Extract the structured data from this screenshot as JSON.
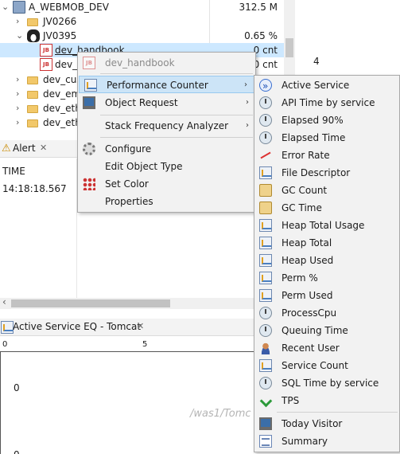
{
  "tree": {
    "rows": [
      {
        "label": "A_WEBMOB_DEV",
        "value": "312.5 M"
      },
      {
        "label": "JV0266",
        "value": ""
      },
      {
        "label": "JV0395",
        "value": "0.65 %"
      },
      {
        "label": "dev_handbook",
        "value": "0 cnt"
      },
      {
        "label": "dev_h",
        "value": "0 cnt"
      },
      {
        "label": "dev_cust",
        "value": ""
      },
      {
        "label": "dev_emp",
        "value": ""
      },
      {
        "label": "dev_ethi",
        "value": ""
      },
      {
        "label": "dev_ethi",
        "value": ""
      }
    ]
  },
  "right_top": {
    "axis_label": "4"
  },
  "alert": {
    "tab_label": "Alert",
    "close_glyph": "✕",
    "column_header": "TIME",
    "rows": [
      "14:18:18.567"
    ]
  },
  "eq": {
    "tab_label": "Active Service EQ - Tomcat",
    "close_glyph": "✕",
    "ruler": [
      "0",
      "5"
    ],
    "y_label": "0",
    "y_label2": "0",
    "watermark": "/was1/Tomc"
  },
  "context_menu": {
    "header": "dev_handbook",
    "items": [
      {
        "label": "Performance Counter",
        "submenu": true,
        "icon": "chart-icon"
      },
      {
        "label": "Object Request",
        "submenu": true,
        "icon": "monitor-icon"
      },
      {
        "label": "Stack Frequency Analyzer",
        "submenu": true,
        "icon": ""
      },
      {
        "label": "Configure",
        "submenu": false,
        "icon": "gear-icon"
      },
      {
        "label": "Edit Object Type",
        "submenu": false,
        "icon": ""
      },
      {
        "label": "Set Color",
        "submenu": false,
        "icon": "color-grid-icon"
      },
      {
        "label": "Properties",
        "submenu": false,
        "icon": ""
      }
    ],
    "arrow_glyph": "›"
  },
  "submenu": {
    "items": [
      {
        "label": "Active Service",
        "icon": "active-service-icon"
      },
      {
        "label": "API Time by service",
        "icon": "clock-icon"
      },
      {
        "label": "Elapsed 90%",
        "icon": "clock-icon"
      },
      {
        "label": "Elapsed Time",
        "icon": "clock-icon"
      },
      {
        "label": "Error Rate",
        "icon": "error-rate-icon"
      },
      {
        "label": "File Descriptor",
        "icon": "chart-icon"
      },
      {
        "label": "GC Count",
        "icon": "gc-icon"
      },
      {
        "label": "GC Time",
        "icon": "gc-icon"
      },
      {
        "label": "Heap Total Usage",
        "icon": "chart-icon"
      },
      {
        "label": "Heap Total",
        "icon": "chart-icon"
      },
      {
        "label": "Heap Used",
        "icon": "chart-icon"
      },
      {
        "label": "Perm %",
        "icon": "chart-icon"
      },
      {
        "label": "Perm Used",
        "icon": "chart-icon"
      },
      {
        "label": "ProcessCpu",
        "icon": "clock-icon"
      },
      {
        "label": "Queuing Time",
        "icon": "clock-icon"
      },
      {
        "label": "Recent User",
        "icon": "user-icon"
      },
      {
        "label": "Service Count",
        "icon": "service-count-icon"
      },
      {
        "label": "SQL Time by service",
        "icon": "clock-icon"
      },
      {
        "label": "TPS",
        "icon": "tps-icon"
      },
      {
        "label": "Today Visitor",
        "icon": "monitor-icon"
      },
      {
        "label": "Summary",
        "icon": "summary-icon"
      }
    ]
  }
}
